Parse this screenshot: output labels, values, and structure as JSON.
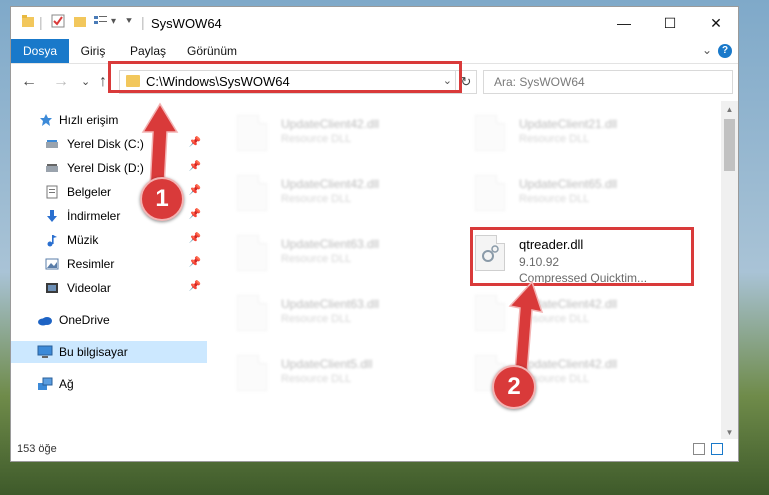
{
  "window": {
    "title": "SysWOW64",
    "quick_access_icons": [
      "folder-icon",
      "properties-check-icon",
      "new-folder-icon",
      "view-menu-icon",
      "customize-dropdown-icon"
    ],
    "controls": {
      "minimize": "—",
      "maximize": "☐",
      "close": "✕"
    }
  },
  "ribbon": {
    "tabs": [
      "Dosya",
      "Giriş",
      "Paylaş",
      "Görünüm"
    ],
    "active_tab": "Dosya",
    "accent": "#1979ca",
    "help": "?",
    "collapse": "⌄"
  },
  "nav": {
    "back": "←",
    "forward": "→",
    "recent": "⌄",
    "up": "↑",
    "address": "C:\\Windows\\SysWOW64",
    "refresh": "↻",
    "dropdown": "⌄",
    "search_placeholder": "Ara: SysWOW64"
  },
  "sidebar": {
    "items": [
      {
        "label": "Hızlı erişim",
        "icon": "star-icon",
        "pinned": false
      },
      {
        "label": "Yerel Disk (C:)",
        "icon": "drive-icon",
        "pinned": true
      },
      {
        "label": "Yerel Disk (D:)",
        "icon": "drive-icon",
        "pinned": true
      },
      {
        "label": "Belgeler",
        "icon": "documents-icon",
        "pinned": true
      },
      {
        "label": "İndirmeler",
        "icon": "download-icon",
        "pinned": true
      },
      {
        "label": "Müzik",
        "icon": "music-icon",
        "pinned": true
      },
      {
        "label": "Resimler",
        "icon": "pictures-icon",
        "pinned": true
      },
      {
        "label": "Videolar",
        "icon": "video-icon",
        "pinned": true
      },
      {
        "label": "OneDrive",
        "icon": "cloud-icon",
        "pinned": false
      },
      {
        "label": "Bu bilgisayar",
        "icon": "computer-icon",
        "pinned": false,
        "selected": true
      },
      {
        "label": "Ağ",
        "icon": "network-icon",
        "pinned": false
      }
    ],
    "pin_glyph": "📌"
  },
  "files": [
    {
      "name": "UpdateClient42.dll",
      "type": "Resource DLL"
    },
    {
      "name": "UpdateClient21.dll",
      "type": "Resource DLL"
    },
    {
      "name": "UpdateClient42.dll",
      "type": "Resource DLL"
    },
    {
      "name": "UpdateClient65.dll",
      "type": "Resource DLL"
    },
    {
      "name": "UpdateClient63.dll",
      "type": "Resource DLL"
    },
    {
      "name": "qtreader.dll",
      "version": "9.10.92",
      "description": "Compressed Quicktim..."
    },
    {
      "name": "UpdateClient63.dll",
      "type": "Resource DLL"
    },
    {
      "name": "UpdateClient42.dll",
      "type": "Resource DLL"
    },
    {
      "name": "UpdateClient5.dll",
      "type": "Resource DLL"
    },
    {
      "name": "UpdateClient42.dll",
      "type": "Resource DLL"
    }
  ],
  "status": {
    "count": "153 öğe"
  },
  "annotations": {
    "step1": "1",
    "step2": "2",
    "color": "#d93a3a"
  }
}
